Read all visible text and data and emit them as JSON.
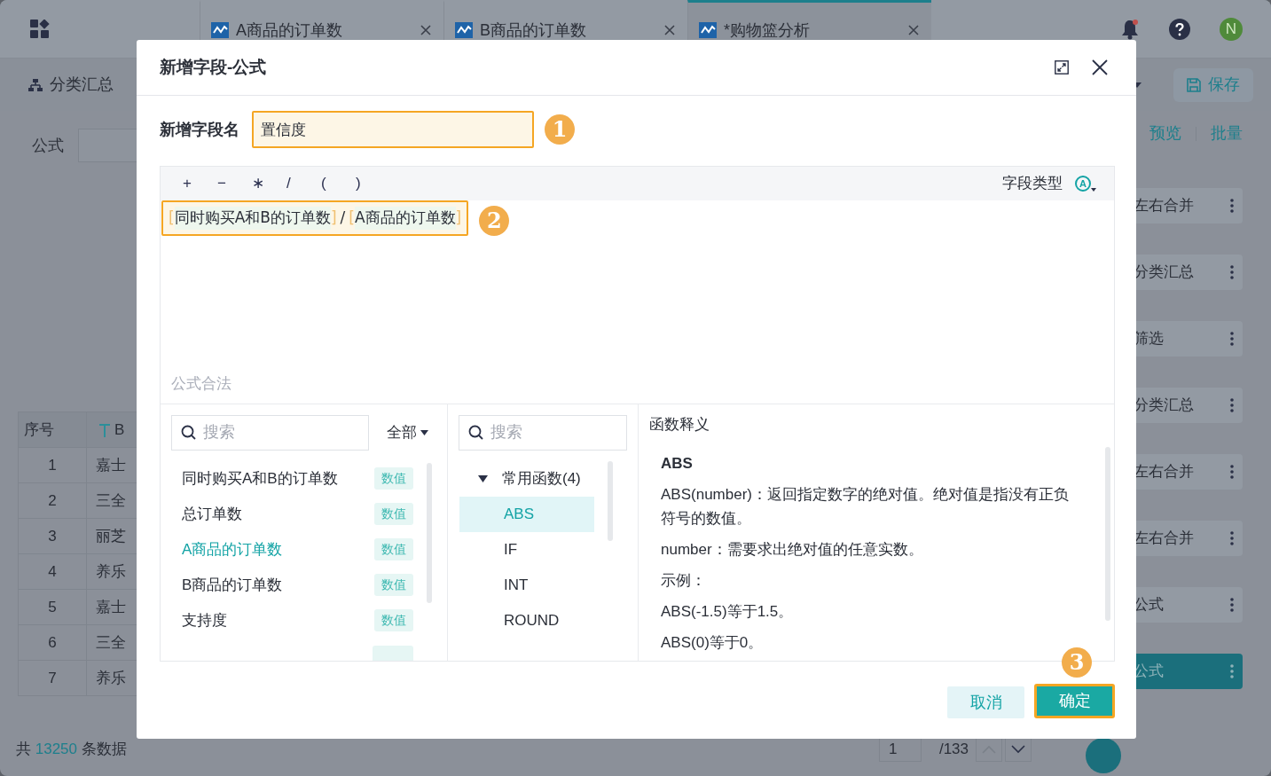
{
  "app": {
    "tabs": [
      {
        "label": "A商品的订单数",
        "selected": false
      },
      {
        "label": "B商品的订单数",
        "selected": false
      },
      {
        "label": "*购物篮分析",
        "selected": true
      }
    ],
    "avatar": "N",
    "has_notification": true,
    "group_button": "分类汇总",
    "save_button": "保存",
    "formula_label": "公式",
    "links": [
      "预览",
      "批量"
    ],
    "table": {
      "columns": [
        "序号",
        "B"
      ],
      "rows": [
        [
          "1",
          "嘉士"
        ],
        [
          "2",
          "三全"
        ],
        [
          "3",
          "丽芝"
        ],
        [
          "4",
          "养乐"
        ],
        [
          "5",
          "嘉士"
        ],
        [
          "6",
          "三全"
        ],
        [
          "7",
          "养乐"
        ]
      ]
    },
    "footer": {
      "prefix": "共",
      "count": "13250",
      "suffix": "条数据",
      "page": "1",
      "total_pages": "/133"
    },
    "steps": [
      {
        "label": "左右合并",
        "selected": false
      },
      {
        "label": "分类汇总",
        "selected": false
      },
      {
        "label": "筛选",
        "selected": false
      },
      {
        "label": "分类汇总",
        "selected": false
      },
      {
        "label": "左右合并",
        "selected": false
      },
      {
        "label": "左右合并",
        "selected": false
      },
      {
        "label": "公式",
        "selected": false
      },
      {
        "label": "公式",
        "selected": true
      }
    ]
  },
  "dialog": {
    "title": "新增字段-公式",
    "name_label": "新增字段名",
    "name_value": "置信度",
    "operators": [
      "+",
      "−",
      "∗",
      "/",
      "(",
      ")"
    ],
    "field_type_label": "字段类型",
    "field_type_symbol": "A",
    "formula": {
      "bracket_open": "[",
      "bracket_close": "]",
      "tokens": [
        {
          "kind": "field",
          "text": "同时购买A和B的订单数"
        },
        {
          "kind": "op",
          "text": "/"
        },
        {
          "kind": "field",
          "text": "A商品的订单数"
        }
      ]
    },
    "status": "公式合法",
    "fields": {
      "search_placeholder": "搜索",
      "filter": "全部",
      "items": [
        {
          "name": "同时购买A和B的订单数",
          "type": "数值",
          "selected": false
        },
        {
          "name": "总订单数",
          "type": "数值",
          "selected": false
        },
        {
          "name": "A商品的订单数",
          "type": "数值",
          "selected": true
        },
        {
          "name": "B商品的订单数",
          "type": "数值",
          "selected": false
        },
        {
          "name": "支持度",
          "type": "数值",
          "selected": false
        }
      ]
    },
    "functions": {
      "search_placeholder": "搜索",
      "groups": [
        {
          "label": "常用函数(4)",
          "expanded": true,
          "children": [
            {
              "label": "ABS",
              "selected": true
            },
            {
              "label": "IF",
              "selected": false
            },
            {
              "label": "INT",
              "selected": false
            },
            {
              "label": "ROUND",
              "selected": false
            }
          ]
        }
      ]
    },
    "help": {
      "heading": "函数释义",
      "title": "ABS",
      "paragraphs": [
        "ABS(number)：返回指定数字的绝对值。绝对值是指没有正负符号的数值。",
        "number：需要求出绝对值的任意实数。",
        "示例：",
        "ABS(-1.5)等于1.5。",
        "ABS(0)等于0。"
      ]
    },
    "cancel_button": "取消",
    "confirm_button": "确定",
    "markers": [
      "1",
      "2",
      "3"
    ]
  }
}
